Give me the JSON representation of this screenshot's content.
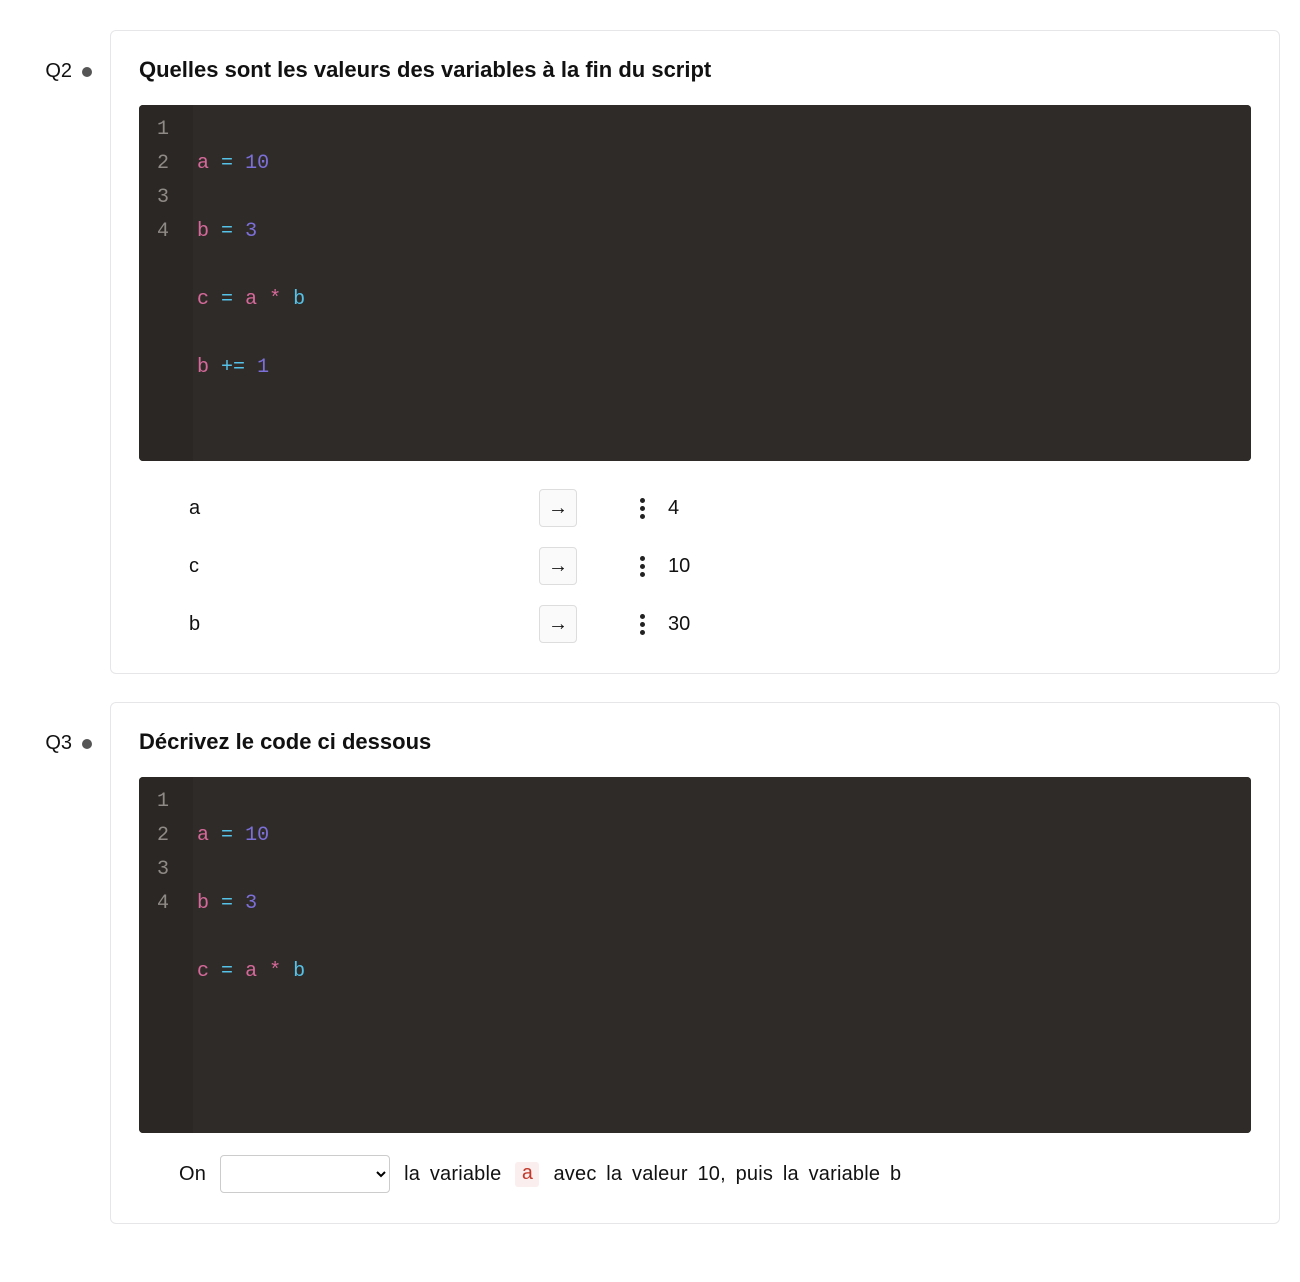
{
  "q2": {
    "label": "Q2",
    "title": "Quelles sont les valeurs des variables à la fin du script",
    "code": {
      "lines": [
        "1",
        "2",
        "3",
        "4"
      ],
      "l1": {
        "a": "a",
        "eq": "=",
        "n": "10"
      },
      "l2": {
        "b": "b",
        "eq": "=",
        "n": "3"
      },
      "l3": {
        "c": "c",
        "eq": "=",
        "a": "a",
        "star": "*",
        "b": "b"
      },
      "l4": {
        "b": "b",
        "pe": "+=",
        "n": "1"
      }
    },
    "matches": {
      "left": [
        "a",
        "c",
        "b"
      ],
      "arrow": "→",
      "right": [
        "4",
        "10",
        "30"
      ]
    }
  },
  "q3": {
    "label": "Q3",
    "title": "Décrivez le code ci dessous",
    "code": {
      "lines": [
        "1",
        "2",
        "3",
        "4"
      ],
      "l1": {
        "a": "a",
        "eq": "=",
        "n": "10"
      },
      "l2": {
        "b": "b",
        "eq": "=",
        "n": "3"
      },
      "l3": {
        "c": "c",
        "eq": "=",
        "a": "a",
        "star": "*",
        "b": "b"
      }
    },
    "fill": {
      "pre": "On",
      "select_placeholder": "",
      "post_t1": "la  variable",
      "code_a": "a",
      "post_t2": "avec  la  valeur  10,  puis  la  variable  b"
    }
  }
}
